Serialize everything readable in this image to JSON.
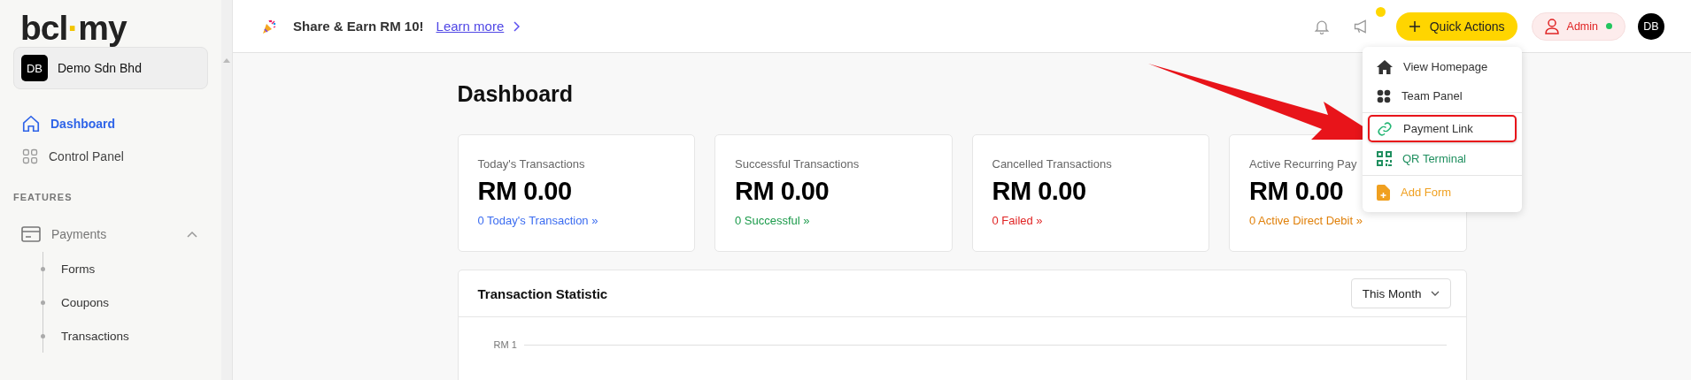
{
  "sidebar": {
    "logo": {
      "text": "bcl",
      "dot": "·",
      "suffix": "my"
    },
    "organization": {
      "initials": "DB",
      "name": "Demo Sdn Bhd"
    },
    "nav": [
      {
        "label": "Dashboard",
        "kind": "home",
        "selected": true
      },
      {
        "label": "Control Panel",
        "kind": "grid",
        "selected": false
      }
    ],
    "section_title": "FEATURES",
    "groups": [
      {
        "label": "Payments",
        "expanded": true,
        "children": [
          {
            "label": "Forms"
          },
          {
            "label": "Coupons"
          },
          {
            "label": "Transactions"
          }
        ]
      }
    ]
  },
  "top_bar": {
    "promo": {
      "text": "Share & Earn RM 10!",
      "link": "Learn more"
    },
    "notifications_unread": false,
    "announcements_unread": true,
    "quick_actions": {
      "label": "Quick Actions",
      "expanded": true
    },
    "role": {
      "label": "Admin",
      "online": true
    },
    "avatar": "DB"
  },
  "quick_actions_menu": {
    "sections": [
      [
        {
          "label": "View Homepage",
          "kind": "home",
          "color": "#333333",
          "highlighted": false
        },
        {
          "label": "Team Panel",
          "kind": "dots",
          "color": "#333333",
          "highlighted": false
        }
      ],
      [
        {
          "label": "Payment Link",
          "kind": "link",
          "color": "#22b573",
          "highlighted": true
        },
        {
          "label": "QR Terminal",
          "kind": "qr",
          "color": "#1f8f5f",
          "highlighted": false
        }
      ],
      [
        {
          "label": "Add Form",
          "kind": "file",
          "color": "#f0a020",
          "highlighted": false
        }
      ]
    ]
  },
  "page_title": "Dashboard",
  "stat_cards": [
    {
      "title": "Today's Transactions",
      "amount": "RM 0.00",
      "link": "0 Today's Transaction »",
      "color": "#3b6cf0"
    },
    {
      "title": "Successful Transactions",
      "amount": "RM 0.00",
      "link": "0 Successful »",
      "color": "#1a9a4a"
    },
    {
      "title": "Cancelled Transactions",
      "amount": "RM 0.00",
      "link": "0 Failed »",
      "color": "#e02424"
    },
    {
      "title": "Active Recurring Pay",
      "amount": "RM 0.00",
      "link": "0 Active Direct Debit »",
      "color": "#e0800a"
    }
  ],
  "transaction_statistic": {
    "title": "Transaction Statistic",
    "period": "This Month",
    "axis_labels": [
      "RM 1"
    ]
  }
}
